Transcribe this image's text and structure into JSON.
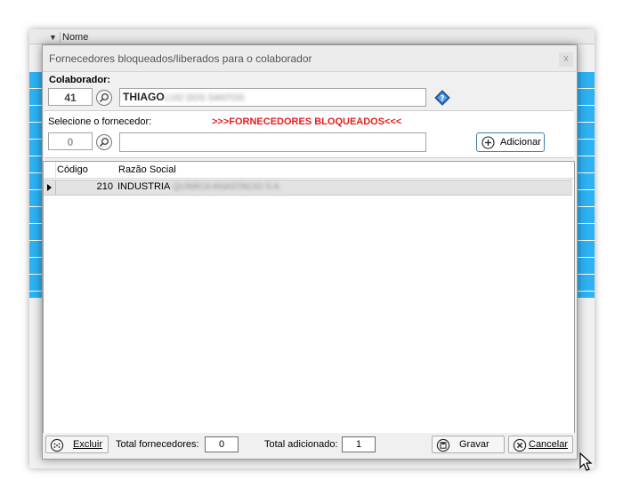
{
  "background": {
    "column_header": "Nome"
  },
  "dialog": {
    "title": "Fornecedores bloqueados/liberados para o colaborador",
    "close_label": "x"
  },
  "colaborador": {
    "label": "Colaborador:",
    "code": "41",
    "name_visible": "THIAGO",
    "name_obscured": "LUIZ DOS SANTOS"
  },
  "fornecedor": {
    "label": "Selecione o fornecedor:",
    "blocked_label": ">>>FORNECEDORES BLOQUEADOS<<<",
    "code": "0",
    "input_value": "",
    "add_button": "Adicionar"
  },
  "grid": {
    "columns": [
      "Código",
      "Razão Social"
    ],
    "rows": [
      {
        "codigo": "210",
        "razao_visible": "INDUSTRIA",
        "razao_obscured": " QUIMICA ANASTACIO S A"
      }
    ]
  },
  "footer": {
    "delete_button": "Excluir",
    "total_fornecedores_label": "Total fornecedores:",
    "total_fornecedores": "0",
    "total_adicionado_label": "Total adicionado:",
    "total_adicionado": "1",
    "save_button": "Gravar",
    "cancel_button": "Cancelar"
  },
  "colors": {
    "accent_blue": "#2db3f4",
    "blocked_red": "#e02020",
    "button_border_blue": "#3c7fb1"
  }
}
